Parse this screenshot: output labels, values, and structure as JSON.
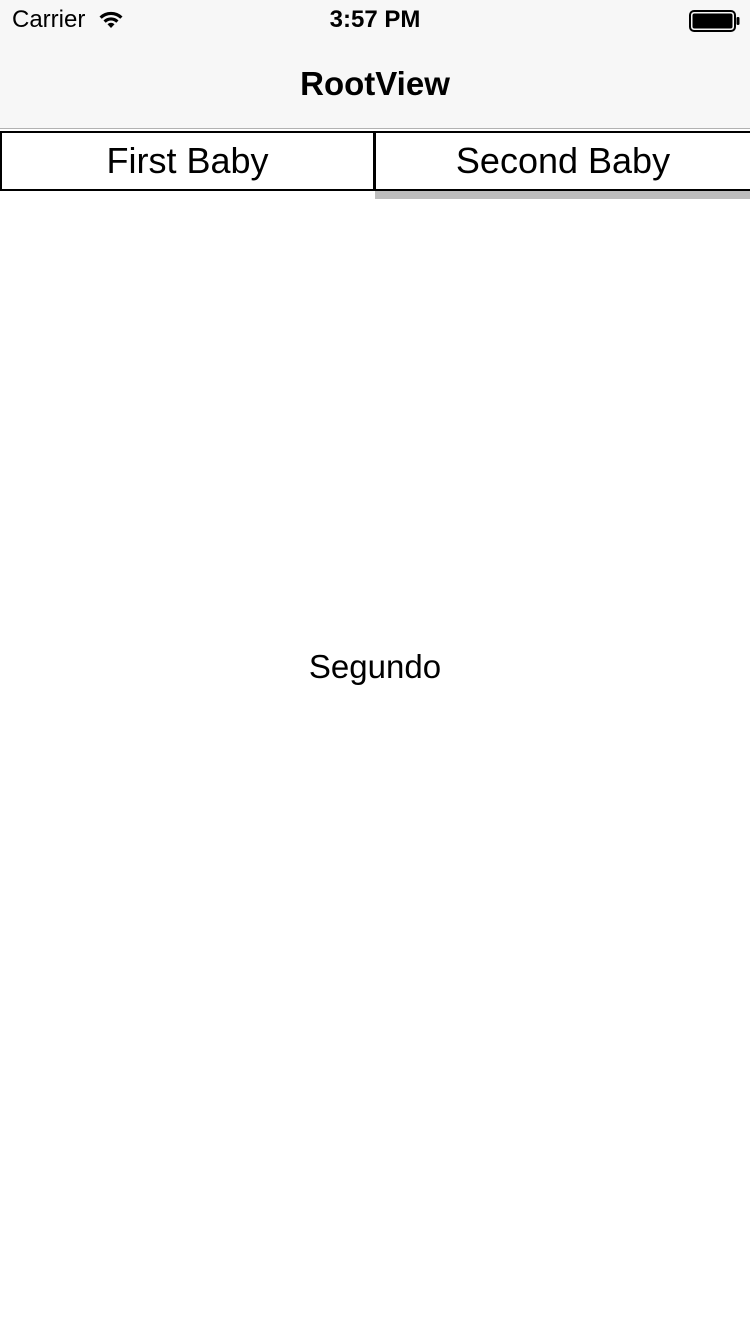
{
  "status_bar": {
    "carrier": "Carrier",
    "time": "3:57 PM",
    "wifi_icon": "wifi-icon",
    "battery_icon": "battery-full-icon"
  },
  "nav_bar": {
    "title": "RootView"
  },
  "tabs": [
    {
      "label": "First Baby",
      "selected": false
    },
    {
      "label": "Second Baby",
      "selected": true
    }
  ],
  "content": {
    "label": "Segundo"
  },
  "colors": {
    "nav_background": "#f7f7f7",
    "tab_indicator": "#bdbdbd",
    "text": "#000000"
  }
}
